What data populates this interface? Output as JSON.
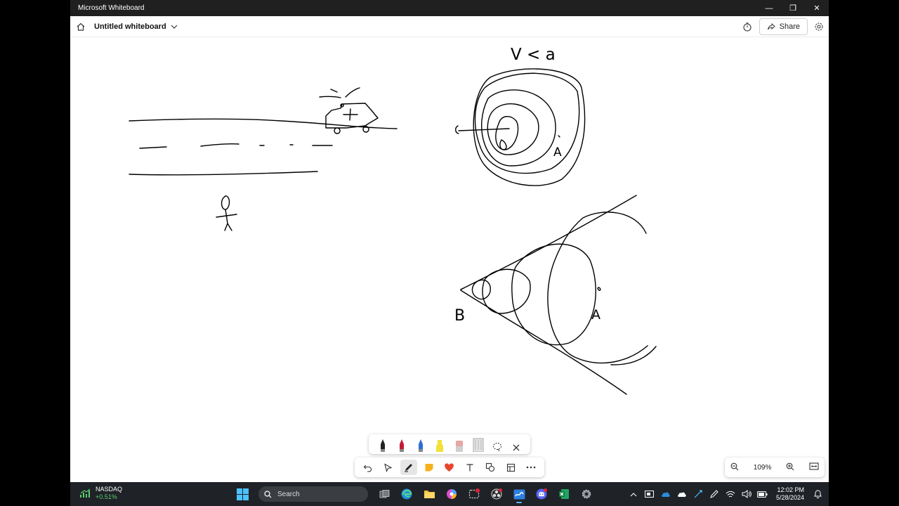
{
  "window": {
    "title": "Microsoft Whiteboard",
    "minimize": "—",
    "restore": "❐",
    "close": "✕"
  },
  "header": {
    "board_name": "Untitled whiteboard",
    "share_label": "Share"
  },
  "canvas": {
    "ink_labels": {
      "condition": "V < a",
      "point_a_top": "A",
      "point_a_bottom": "A",
      "point_b": "B"
    }
  },
  "pens": [
    "black-pen",
    "red-pen",
    "blue-pen",
    "yellow-highlighter",
    "pink-eraser",
    "ruler",
    "lasso-select",
    "close-tray"
  ],
  "tools": [
    "undo",
    "select",
    "ink-pen",
    "sticky-note",
    "reactions",
    "text",
    "shapes",
    "templates",
    "more"
  ],
  "zoom": {
    "level": "109%"
  },
  "taskbar": {
    "stock_name": "NASDAQ",
    "stock_change": "+0.51%",
    "search_placeholder": "Search",
    "time": "12:02 PM",
    "date": "5/28/2024"
  },
  "colors": {
    "titlebar": "#202020",
    "taskbar": "#1f2227",
    "accent": "#0078d4",
    "ink": "#000000"
  }
}
